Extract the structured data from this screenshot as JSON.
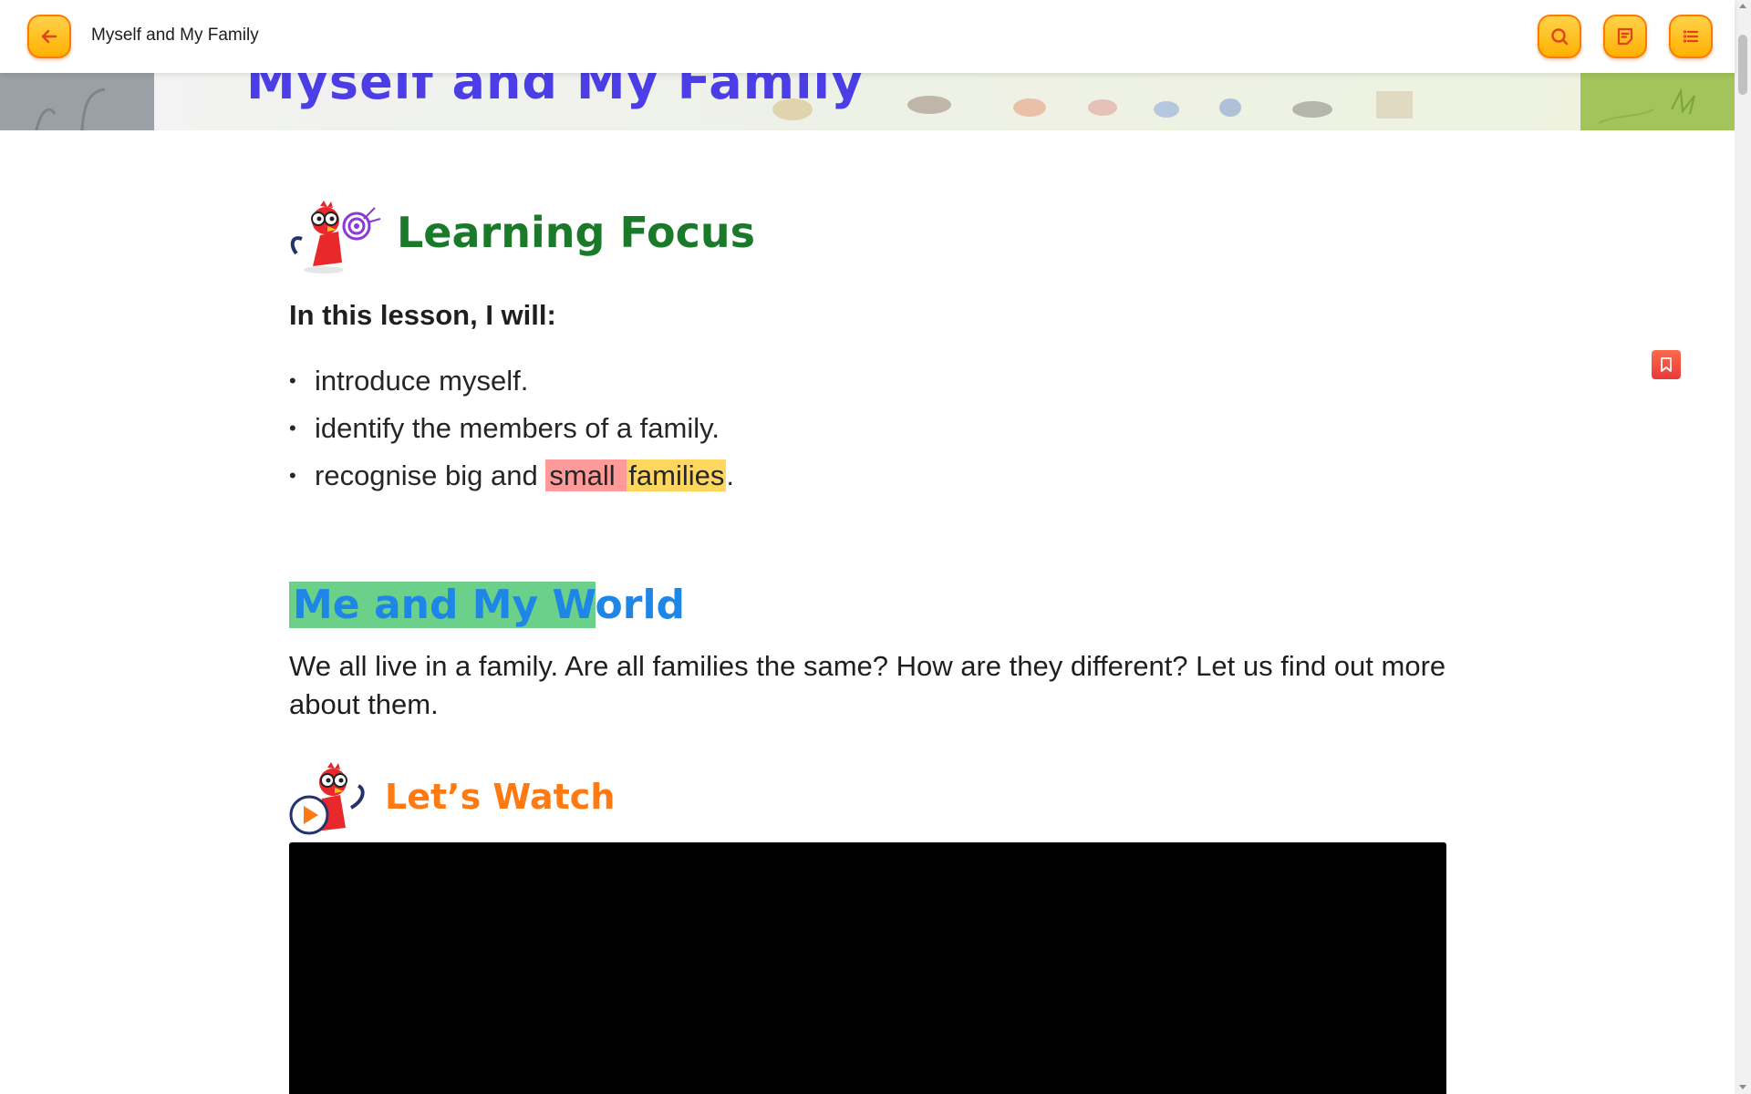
{
  "header": {
    "title": "Myself and My Family",
    "back_icon": "arrow-left-icon",
    "search_icon": "search-icon",
    "notes_icon": "notes-icon",
    "menu_icon": "list-menu-icon"
  },
  "banner": {
    "title": "Myself and My Family"
  },
  "learning_focus": {
    "heading": "Learning Focus",
    "intro": "In this lesson, I will:",
    "bullet": "•",
    "goals": [
      "introduce myself.",
      "identify the members of a family."
    ],
    "goal3": {
      "prefix": "recognise big and ",
      "highlight_red": "small ",
      "highlight_yellow": "families",
      "suffix": "."
    }
  },
  "world_section": {
    "heading_highlight": "Me and My W",
    "heading_rest": "orld",
    "paragraph": "We all live in a family. Are all families the same? How are they different? Let us find out more about them."
  },
  "watch_section": {
    "heading": "Let’s Watch"
  },
  "colors": {
    "accent_orange": "#ff9f00",
    "banner_title": "#4c3ee6",
    "learning_focus": "#1a7a2a",
    "world_heading": "#1d86e6",
    "watch_heading": "#ff7a12",
    "highlight_red": "#ff9a9a",
    "highlight_yellow": "#ffd75e",
    "highlight_green": "#6ad08a"
  },
  "bookmark_icon": "bookmark-icon"
}
